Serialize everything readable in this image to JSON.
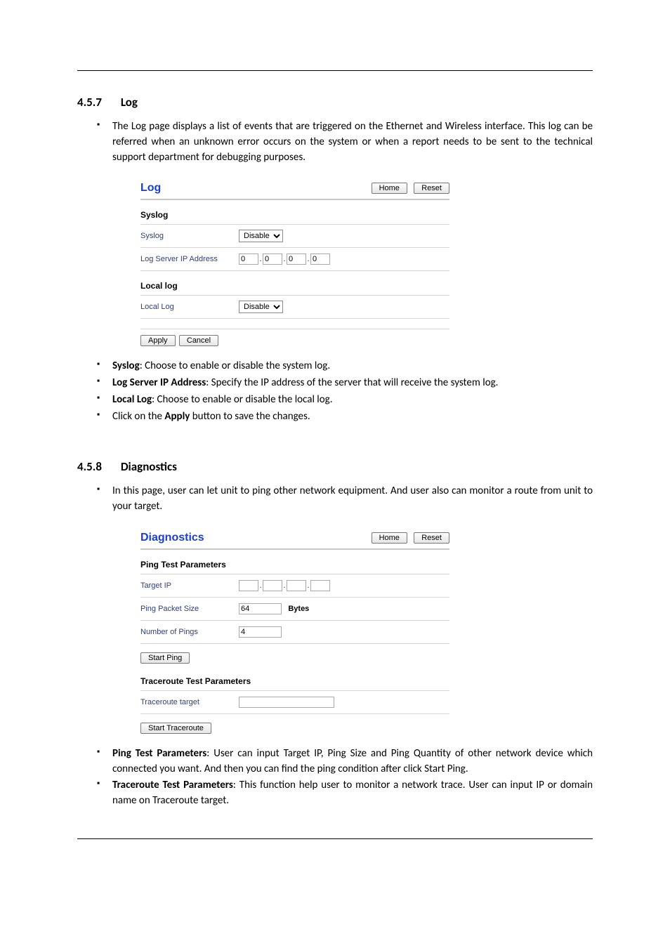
{
  "section1": {
    "number": "4.5.7",
    "title": "Log",
    "intro": "The Log page displays a list of events that are triggered on the Ethernet and Wireless interface. This log can be referred when an unknown error occurs on the system or when a report needs to be sent to the technical support department for debugging purposes.",
    "bullets": [
      {
        "b": "Syslog",
        "rest": ": Choose to enable or disable the system log."
      },
      {
        "b": "Log Server IP Address",
        "rest": ": Specify the IP address of the server that will receive the system log."
      },
      {
        "b": "Local Log",
        "rest": ": Choose to enable or disable the local log."
      },
      {
        "b2": "Apply",
        "pre": "Click on the ",
        "post": " button to save the changes."
      }
    ]
  },
  "section2": {
    "number": "4.5.8",
    "title": "Diagnostics",
    "intro": "In this page, user can let unit to ping other network equipment. And user also can monitor a route from unit to your target.",
    "bullets": [
      {
        "b": "Ping Test Parameters",
        "rest": ": User can input Target IP, Ping Size and Ping Quantity of other network device which connected you want. And then you can find the ping condition after click Start Ping."
      },
      {
        "b": "Traceroute Test Parameters",
        "rest": ": This function help user to monitor a network trace. User can input IP or domain name on Traceroute target."
      }
    ]
  },
  "log_ui": {
    "title": "Log",
    "home": "Home",
    "reset": "Reset",
    "syslog_head": "Syslog",
    "syslog_label": "Syslog",
    "syslog_value": "Disable",
    "ip_label": "Log Server IP Address",
    "ip": [
      "0",
      "0",
      "0",
      "0"
    ],
    "local_head": "Local log",
    "local_label": "Local Log",
    "local_value": "Disable",
    "apply": "Apply",
    "cancel": "Cancel"
  },
  "diag_ui": {
    "title": "Diagnostics",
    "home": "Home",
    "reset": "Reset",
    "ping_head": "Ping Test Parameters",
    "target_ip_label": "Target IP",
    "target_ip": [
      "",
      "",
      "",
      ""
    ],
    "packet_size_label": "Ping Packet Size",
    "packet_size": "64",
    "packet_unit": "Bytes",
    "num_pings_label": "Number of Pings",
    "num_pings": "4",
    "start_ping": "Start Ping",
    "trace_head": "Traceroute Test Parameters",
    "trace_target_label": "Traceroute target",
    "trace_target": "",
    "start_trace": "Start Traceroute"
  }
}
